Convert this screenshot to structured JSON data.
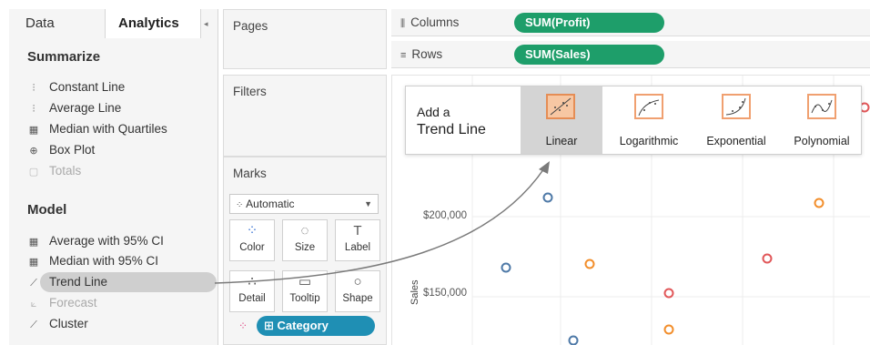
{
  "tabs": {
    "data": "Data",
    "analytics": "Analytics"
  },
  "summarize": {
    "title": "Summarize",
    "items": [
      {
        "label": "Constant Line",
        "icon": "constant-line-icon",
        "glyph": "⫶",
        "dim": false
      },
      {
        "label": "Average Line",
        "icon": "average-line-icon",
        "glyph": "⫶",
        "dim": false
      },
      {
        "label": "Median with Quartiles",
        "icon": "median-quartiles-icon",
        "glyph": "▦",
        "dim": false
      },
      {
        "label": "Box Plot",
        "icon": "box-plot-icon",
        "glyph": "⊕",
        "dim": false
      },
      {
        "label": "Totals",
        "icon": "totals-icon",
        "glyph": "▢",
        "dim": true
      }
    ]
  },
  "model": {
    "title": "Model",
    "items": [
      {
        "label": "Average with 95% CI",
        "icon": "average-ci-icon",
        "glyph": "▦",
        "dim": false
      },
      {
        "label": "Median with 95% CI",
        "icon": "median-ci-icon",
        "glyph": "▦",
        "dim": false
      },
      {
        "label": "Trend Line",
        "icon": "trend-line-icon",
        "glyph": "⟋",
        "dim": false
      },
      {
        "label": "Forecast",
        "icon": "forecast-icon",
        "glyph": "⟀",
        "dim": true
      },
      {
        "label": "Cluster",
        "icon": "cluster-icon",
        "glyph": "⟋",
        "dim": false
      }
    ]
  },
  "cards": {
    "pages": "Pages",
    "filters": "Filters",
    "marks": "Marks"
  },
  "marks": {
    "mark_type": "Automatic",
    "buttons": [
      {
        "label": "Color",
        "icon": "color-icon",
        "glyph": "⁘"
      },
      {
        "label": "Size",
        "icon": "size-icon",
        "glyph": "◌"
      },
      {
        "label": "Label",
        "icon": "label-icon",
        "glyph": "T"
      },
      {
        "label": "Detail",
        "icon": "detail-icon",
        "glyph": "∴"
      },
      {
        "label": "Tooltip",
        "icon": "tooltip-icon",
        "glyph": "▭"
      },
      {
        "label": "Shape",
        "icon": "shape-icon",
        "glyph": "○"
      }
    ],
    "category_pill": "⊞ Category"
  },
  "shelves": {
    "columns_label": "Columns",
    "rows_label": "Rows",
    "columns_pill": "SUM(Profit)",
    "rows_pill": "SUM(Sales)"
  },
  "popover": {
    "add_a": "Add a",
    "title": "Trend Line",
    "options": [
      {
        "label": "Linear",
        "icon": "linear-trend-icon",
        "selected": true
      },
      {
        "label": "Logarithmic",
        "icon": "logarithmic-trend-icon",
        "selected": false
      },
      {
        "label": "Exponential",
        "icon": "exponential-trend-icon",
        "selected": false
      },
      {
        "label": "Polynomial",
        "icon": "polynomial-trend-icon",
        "selected": false
      }
    ]
  },
  "view": {
    "y_axis_title": "Sales",
    "y_ticks": [
      "$200,000",
      "$150,000"
    ]
  },
  "colors": {
    "accent_green": "#1e9e6a",
    "category_blue": "#1f8fb4",
    "mark_orange": "#f0a070"
  }
}
